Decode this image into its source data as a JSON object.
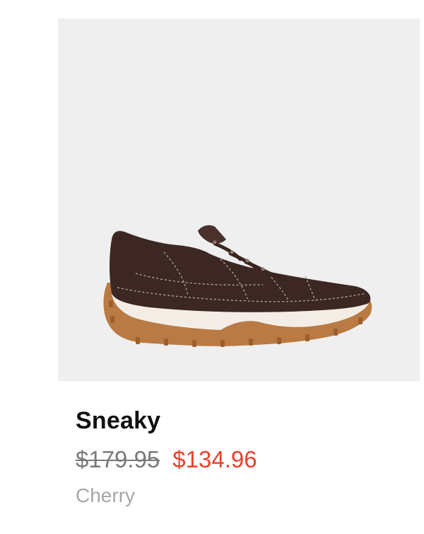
{
  "product": {
    "name": "Sneaky",
    "original_price": "$179.95",
    "sale_price": "$134.96",
    "color_name": "Cherry",
    "image_icon": "sneaker-image"
  },
  "colors": {
    "image_background": "#efefef",
    "sale_price": "#e8422c",
    "color_text": "#a7a7a7",
    "title": "#111111"
  }
}
